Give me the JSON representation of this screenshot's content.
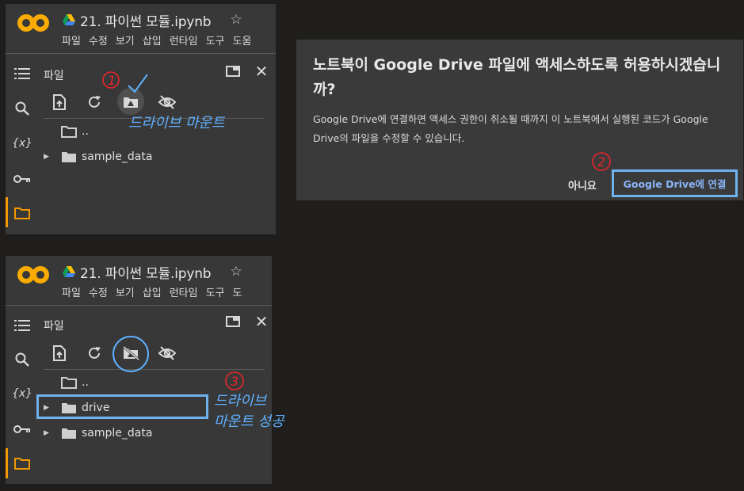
{
  "notebook": {
    "title": "21. 파이썬 모듈.ipynb",
    "menu": [
      "파일",
      "수정",
      "보기",
      "삽입",
      "런타임",
      "도구",
      "도움"
    ],
    "menu_bottom": [
      "파일",
      "수정",
      "보기",
      "삽입",
      "런타임",
      "도구",
      "도"
    ]
  },
  "files_panel": {
    "title": "파일",
    "parent_dir": "..",
    "items_before": [
      "sample_data"
    ],
    "items_after": [
      "drive",
      "sample_data"
    ]
  },
  "dialog": {
    "title": "노트북이 Google Drive 파일에 액세스하도록 허용하시겠습니까?",
    "body": "Google Drive에 연결하면 액세스 권한이 취소될 때까지 이 노트북에서 실행된 코드가 Google Drive의 파일을 수정할 수 있습니다.",
    "cancel_label": "아니요",
    "confirm_label": "Google Drive에 연결"
  },
  "annotations": {
    "step1_label": "드라이브 마운트",
    "step3_line1": "드라이브",
    "step3_line2": "마운트 성공",
    "colors": {
      "blue": "#5fb0ff",
      "red": "#e8262c",
      "accent_orange": "#f29900"
    }
  },
  "icons": [
    "colab-logo",
    "drive-icon",
    "star-icon",
    "toc-icon",
    "search-icon",
    "variables-icon",
    "key-icon",
    "folder-icon",
    "window-icon",
    "close-icon",
    "upload-icon",
    "refresh-icon",
    "mount-drive-icon",
    "hide-icon"
  ]
}
